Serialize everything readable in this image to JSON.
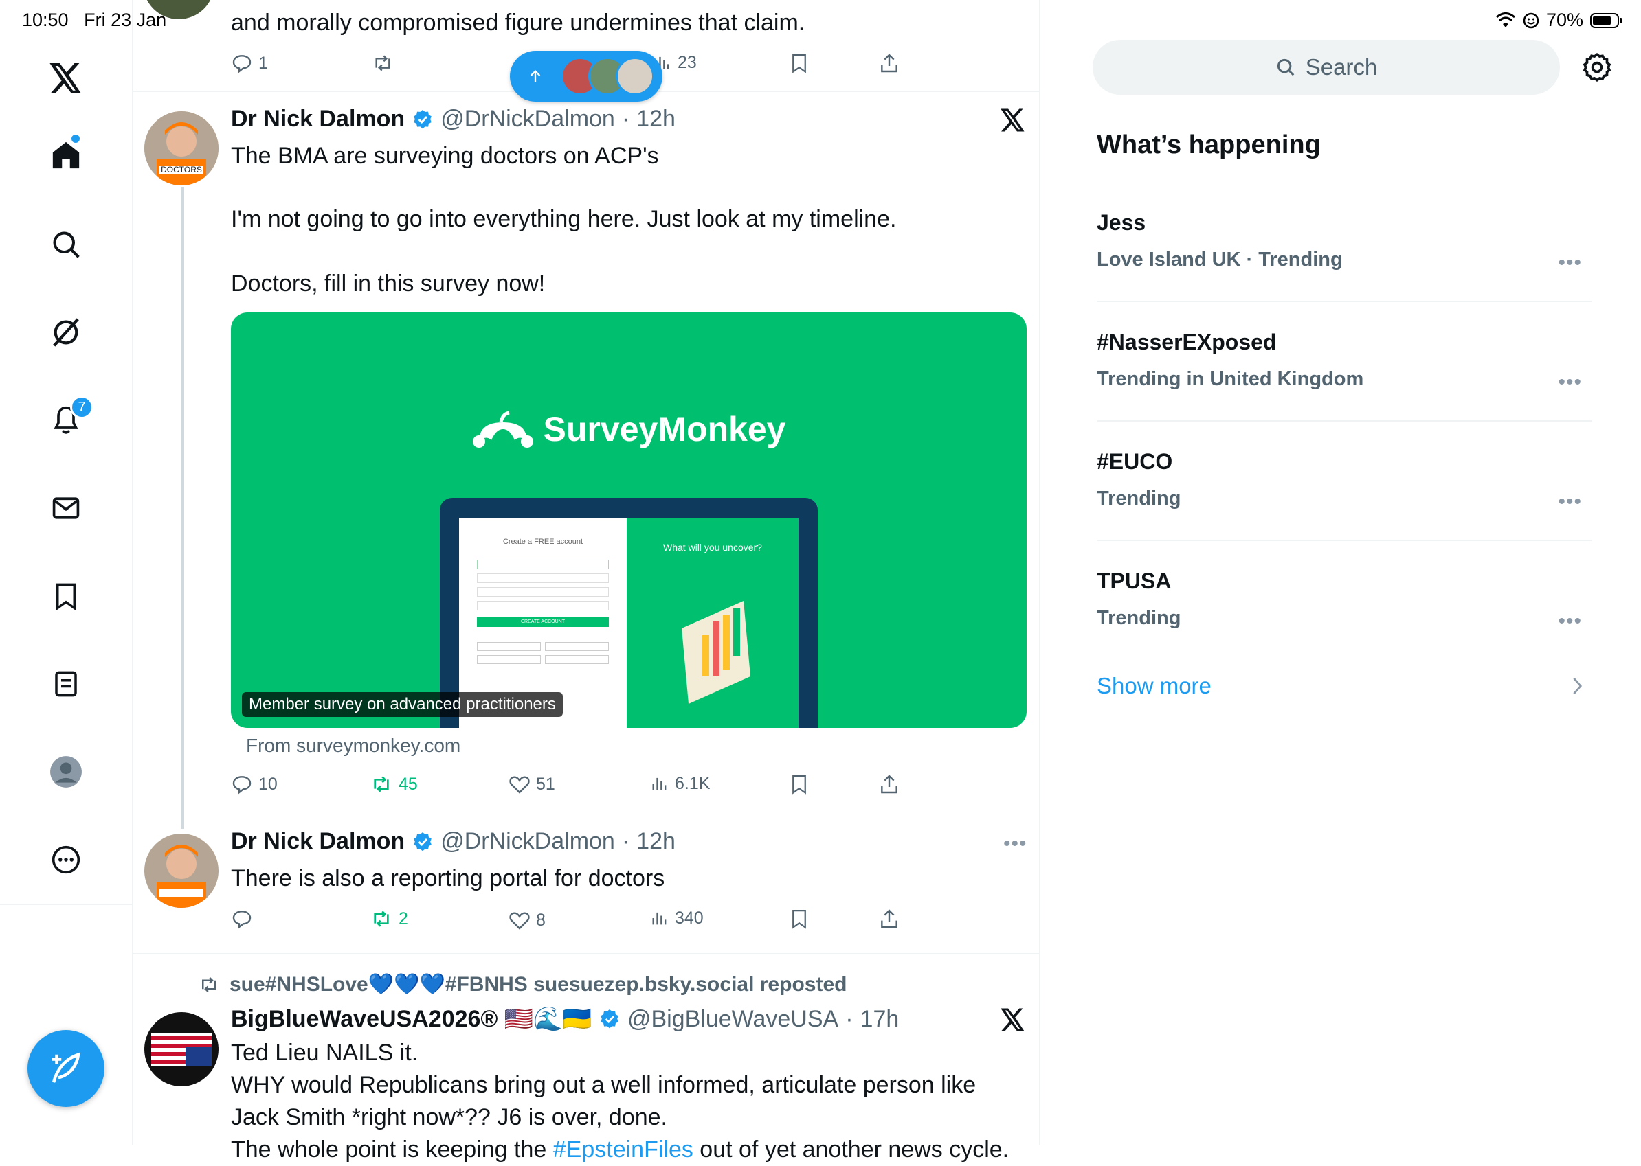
{
  "status": {
    "time": "10:50",
    "date": "Fri 23 Jan",
    "battery": "70%"
  },
  "nav": {
    "notifications_badge": "7"
  },
  "top_tweet": {
    "text": "and morally compromised figure undermines that claim.",
    "replies": "1",
    "views": "23"
  },
  "tweet1": {
    "name": "Dr Nick Dalmon",
    "handle": "@DrNickDalmon",
    "time": "12h",
    "line1": "The BMA are surveying doctors on ACP's",
    "line2": "I'm not going to go into everything here. Just look at my timeline.",
    "line3": "Doctors, fill in this survey now!",
    "card": {
      "brand": "SurveyMonkey",
      "caption": "Member survey on advanced practitioners",
      "source": "From surveymonkey.com",
      "form_title": "Create a FREE account",
      "button": "CREATE ACCOUNT",
      "tagline": "What will you uncover?"
    },
    "replies": "10",
    "reposts": "45",
    "likes": "51",
    "views": "6.1K"
  },
  "tweet2": {
    "name": "Dr Nick Dalmon",
    "handle": "@DrNickDalmon",
    "time": "12h",
    "text": "There is also a reporting portal for doctors",
    "reposts": "2",
    "likes": "8",
    "views": "340"
  },
  "tweet3": {
    "reposted_by": "sue#NHSLove💙💙💙#FBNHS suesuezep.bsky.social reposted",
    "name": "BigBlueWaveUSA2026® 🇺🇸🌊🇺🇦",
    "handle": "@BigBlueWaveUSA",
    "time": "17h",
    "line1": "Ted Lieu NAILS it.",
    "line2": "WHY would Republicans bring out a well informed, articulate person like",
    "line3": "Jack Smith *right now*?? J6 is over, done.",
    "line4_start": "The whole point is keeping the ",
    "line4_link": "#EpsteinFiles",
    "line4_end": " out of yet another news cycle."
  },
  "search": {
    "placeholder": "Search"
  },
  "trends": {
    "title": "What’s happening",
    "items": [
      {
        "name": "Jess",
        "meta": "Love Island UK · Trending"
      },
      {
        "name": "#NasserEXposed",
        "meta": "Trending in United Kingdom"
      },
      {
        "name": "#EUCO",
        "meta": "Trending"
      },
      {
        "name": "TPUSA",
        "meta": "Trending"
      }
    ],
    "show_more": "Show more"
  },
  "colors": {
    "accent": "#1d9bf0",
    "repost_green": "#00ba7c",
    "surveymonkey_green": "#00bf6f"
  }
}
